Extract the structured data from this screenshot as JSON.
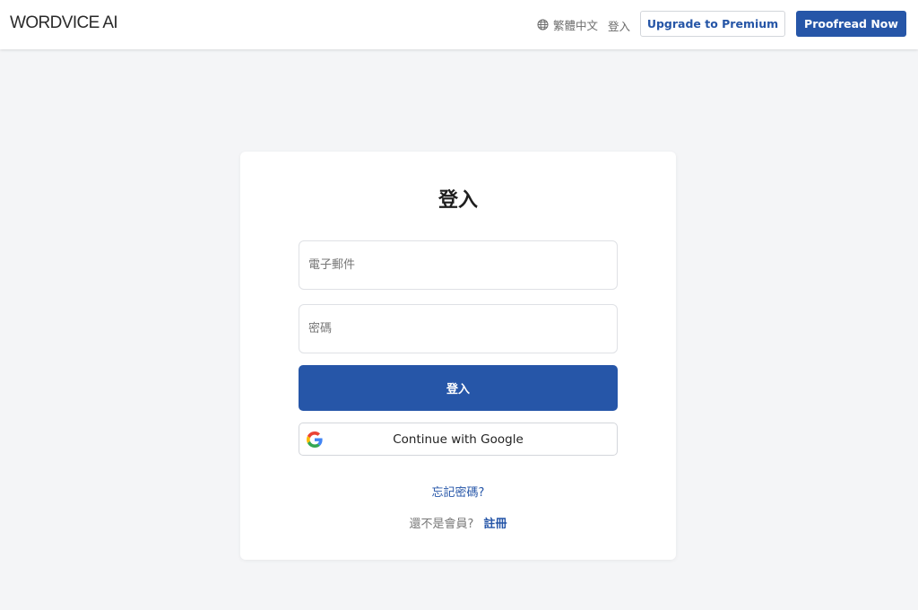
{
  "header": {
    "logo": "WORDVICE AI",
    "language": "繁體中文",
    "login_link": "登入",
    "upgrade_button": "Upgrade to Premium",
    "proofread_button": "Proofread Now"
  },
  "login_card": {
    "title": "登入",
    "email_placeholder": "電子郵件",
    "password_placeholder": "密碼",
    "login_button": "登入",
    "google_button": "Continue with Google",
    "forgot_password": "忘記密碼?",
    "not_member_text": "還不是會員?",
    "signup_link": "註冊"
  },
  "icons": [
    "globe-icon",
    "google-icon"
  ],
  "colors": {
    "primary": "#2656a8",
    "page_background": "#f4f5f7"
  }
}
